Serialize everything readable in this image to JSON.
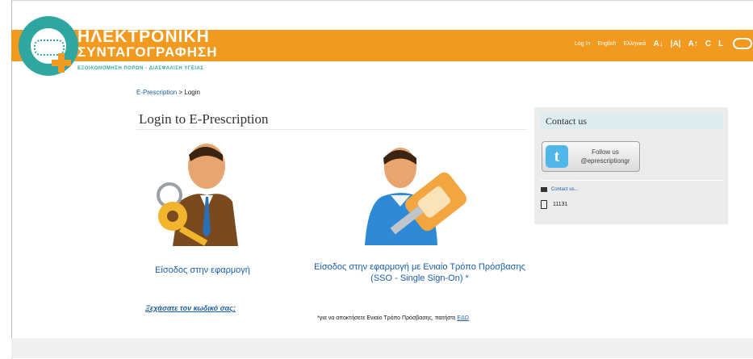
{
  "header": {
    "title_line1": "ΗΛΕΚΤΡΟΝΙΚΗ",
    "title_line2": "ΣΥΝΤΑΓΟΓΡΑΦΗΣΗ",
    "subtitle": "ΕΞΟΙΚΟΝΟΜΗΣΗ ΠΟΡΩΝ - ΔΙΑΣΦΑΛΙΣΗ ΥΓΕΙΑΣ",
    "links": {
      "login": "Log In",
      "english": "English",
      "greek": "Ελληνικά",
      "font_smaller": "A↓",
      "font_reset": "|A|",
      "font_larger": "A↑",
      "contrast": "C",
      "layout": "L"
    }
  },
  "breadcrumb": {
    "home": "E-Prescription",
    "separator": " > ",
    "current": "Login"
  },
  "main": {
    "title": "Login to E-Prescription",
    "login_app": "Είσοδος στην εφαρμογή",
    "login_sso_line1": "Είσοδος στην εφαρμογή με Ενιαίο Τρόπο Πρόσβασης",
    "login_sso_line2": "(SSO - Single Sign-On) *",
    "forgot_password": "Ξεχάσατε τον κωδικό σας;",
    "sso_note": "*για να αποκτήσετε Ενιαίο Τρόπο Πρόσβασης, πατήστε ",
    "sso_note_link": "ΕΔΩ"
  },
  "sidebar": {
    "title": "Contact us",
    "follow_line1": "Follow us",
    "follow_line2": "@eprescriptiongr",
    "contact_link": "Contact us...",
    "phone": "11131"
  }
}
